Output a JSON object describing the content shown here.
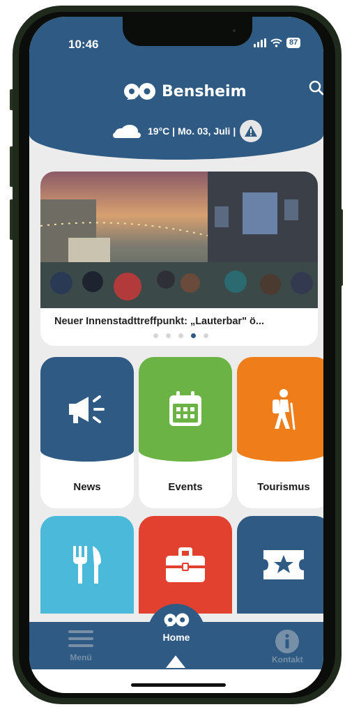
{
  "status_bar": {
    "time": "10:46",
    "battery": "87"
  },
  "header": {
    "app_name": "Bensheim",
    "weather": "19°C | Mo. 03, Juli |"
  },
  "carousel": {
    "caption": "Neuer Innenstadttreffpunkt: „Lauterbar\" ö...",
    "dot_count": 5,
    "active_dot": 4
  },
  "tiles": [
    {
      "label": "News",
      "color": "#2e5a83",
      "icon": "megaphone-icon"
    },
    {
      "label": "Events",
      "color": "#6ab344",
      "icon": "calendar-icon"
    },
    {
      "label": "Tourismus",
      "color": "#ef7d1a",
      "icon": "hiker-icon"
    },
    {
      "label": "",
      "color": "#4ab9da",
      "icon": "cutlery-icon"
    },
    {
      "label": "",
      "color": "#e3412f",
      "icon": "briefcase-icon"
    },
    {
      "label": "",
      "color": "#2e5a83",
      "icon": "ticket-star-icon"
    }
  ],
  "nav": {
    "menu": "Menü",
    "home": "Home",
    "contact": "Kontakt"
  },
  "colors": {
    "primary": "#2e5a83",
    "background": "#ececec",
    "nav_inactive": "#7790a8"
  }
}
